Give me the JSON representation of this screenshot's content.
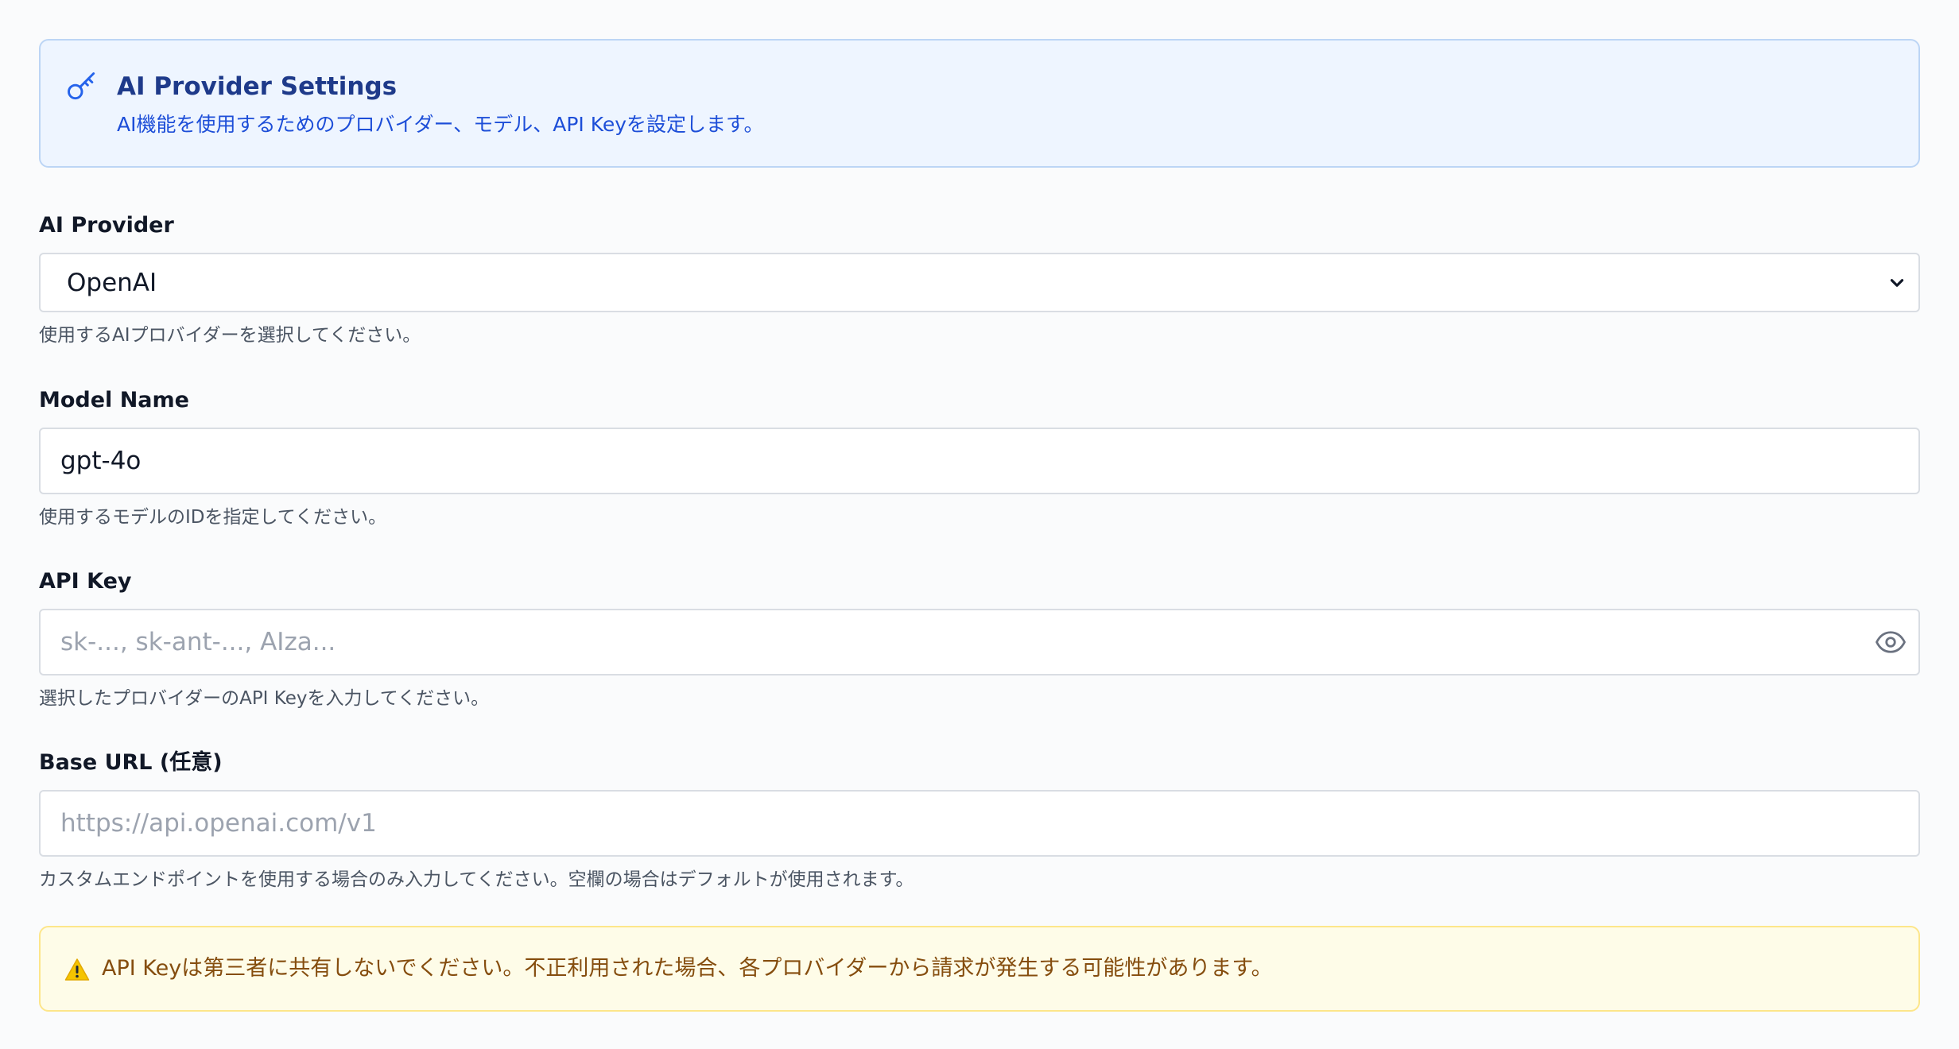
{
  "banner": {
    "title": "AI Provider Settings",
    "description": "AI機能を使用するためのプロバイダー、モデル、API Keyを設定します。",
    "icon": "key-icon"
  },
  "provider": {
    "label": "AI Provider",
    "value": "OpenAI",
    "help": "使用するAIプロバイダーを選択してください。"
  },
  "model": {
    "label": "Model Name",
    "value": "gpt-4o",
    "help": "使用するモデルのIDを指定してください。"
  },
  "api_key": {
    "label": "API Key",
    "placeholder": "sk-..., sk-ant-..., AIza...",
    "help": "選択したプロバイダーのAPI Keyを入力してください。"
  },
  "base_url": {
    "label": "Base URL (任意)",
    "placeholder": "https://api.openai.com/v1",
    "help": "カスタムエンドポイントを使用する場合のみ入力してください。空欄の場合はデフォルトが使用されます。"
  },
  "warning": {
    "icon": "warning-icon",
    "text": "API Keyは第三者に共有しないでください。不正利用された場合、各プロバイダーから請求が発生する可能性があります。"
  },
  "colors": {
    "banner_bg": "#eef5ff",
    "banner_border": "#bcd5f5",
    "banner_title": "#1e3a8a",
    "banner_text": "#1d4ed8",
    "warning_bg": "#fefce8",
    "warning_border": "#fde68a",
    "warning_text": "#854d0e"
  }
}
